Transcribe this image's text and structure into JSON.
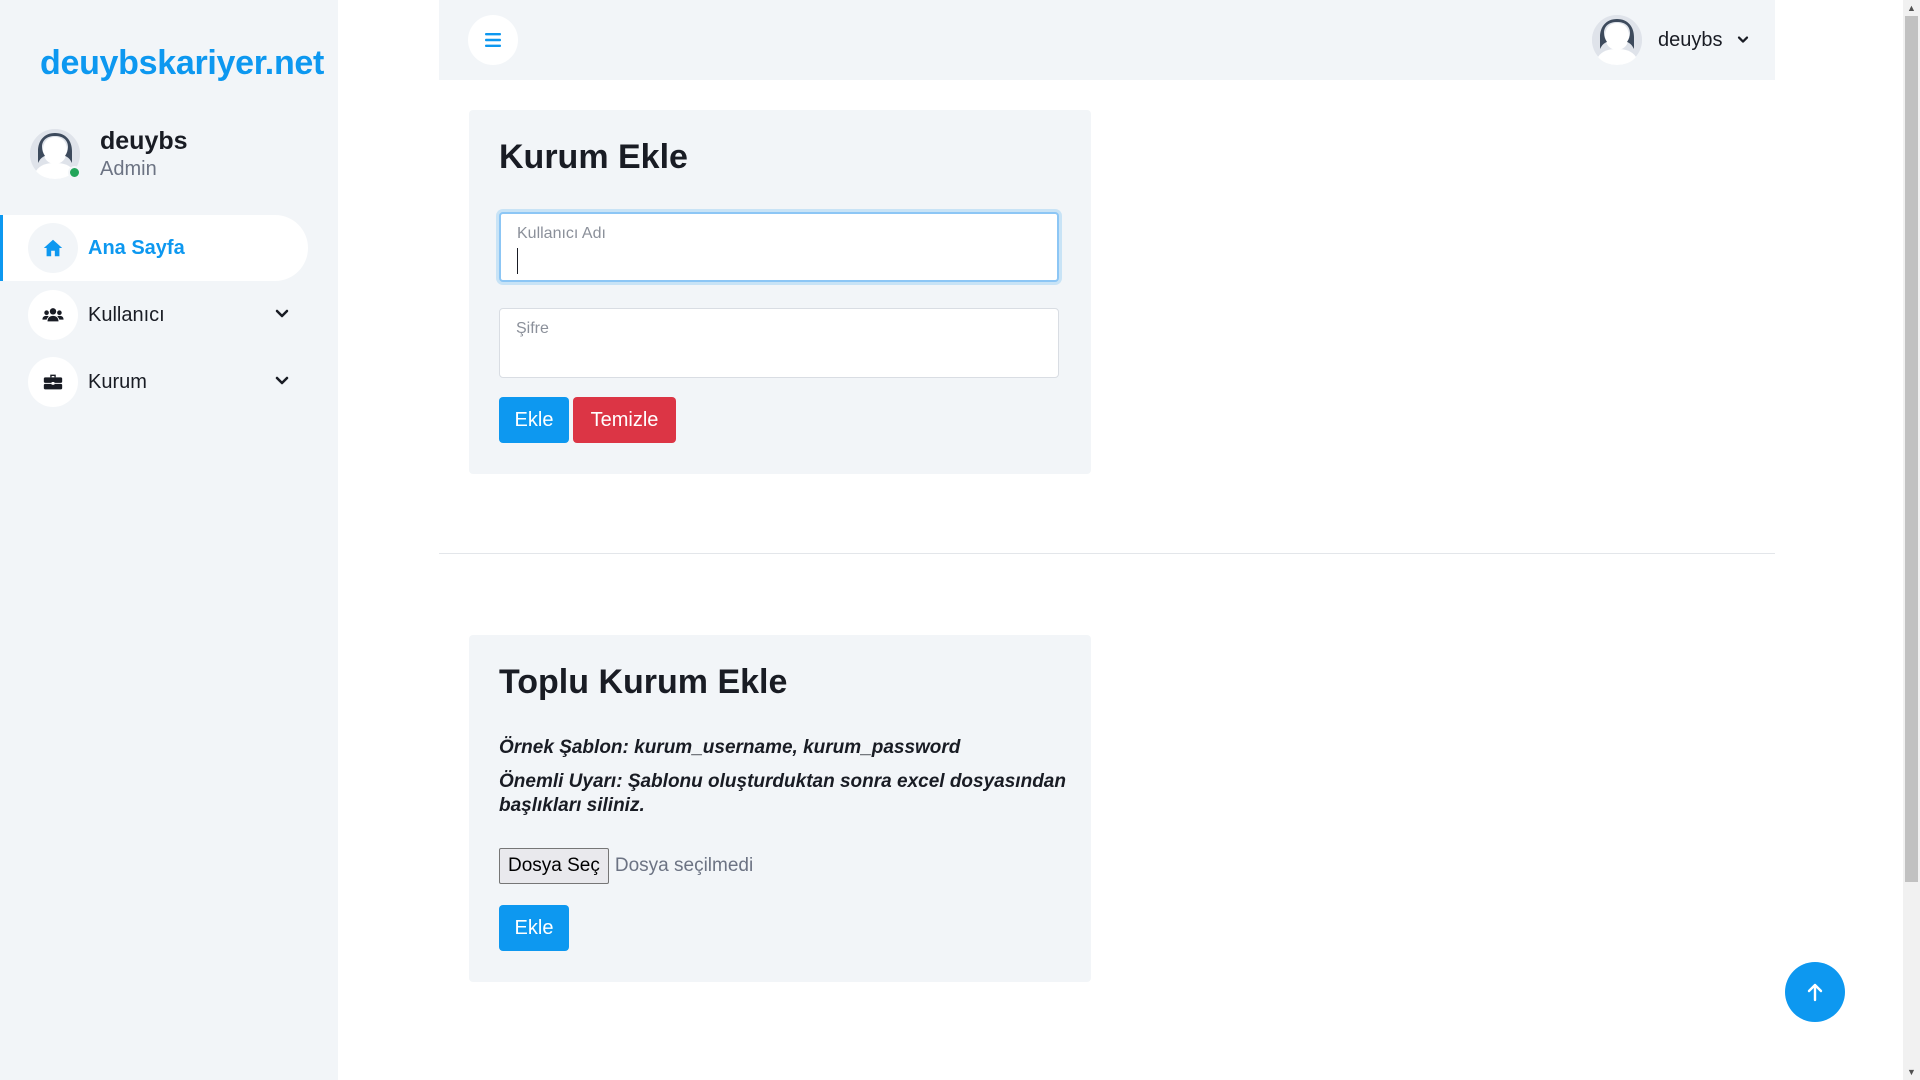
{
  "brand": "deuybskariyer.net",
  "profile": {
    "name": "deuybs",
    "role": "Admin"
  },
  "sidebar": {
    "items": [
      {
        "label": "Ana Sayfa",
        "icon": "home-icon",
        "active": true
      },
      {
        "label": "Kullanıcı",
        "icon": "users-icon",
        "active": false
      },
      {
        "label": "Kurum",
        "icon": "briefcase-icon",
        "active": false
      }
    ]
  },
  "topbar": {
    "user_name": "deuybs"
  },
  "kurum_ekle": {
    "title": "Kurum Ekle",
    "username_placeholder": "Kullanıcı Adı",
    "username_value": "",
    "password_placeholder": "Şifre",
    "password_value": "",
    "add_label": "Ekle",
    "clear_label": "Temizle"
  },
  "toplu_kurum_ekle": {
    "title": "Toplu Kurum Ekle",
    "note_template": "Örnek Şablon: kurum_username, kurum_password",
    "note_warning": "Önemli Uyarı: Şablonu oluşturduktan sonra excel dosyasından başlıkları siliniz.",
    "file_button": "Dosya Seç",
    "file_status": "Dosya seçilmedi",
    "add_label": "Ekle"
  },
  "colors": {
    "accent": "#0d98f0",
    "danger": "#dc3545",
    "online": "#23a55a",
    "panel": "#f2f5f8"
  }
}
